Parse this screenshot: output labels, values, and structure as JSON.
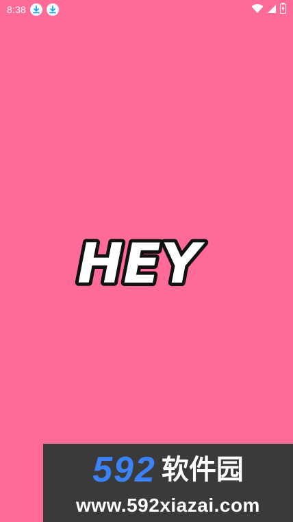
{
  "status_bar": {
    "time": "8:38",
    "notifications": [
      "download-icon",
      "download-icon"
    ],
    "indicators": [
      "wifi-icon",
      "signal-icon",
      "battery-charging-icon"
    ]
  },
  "splash": {
    "logo_text": "HEY"
  },
  "watermark": {
    "number": "592",
    "chinese": "软件园",
    "url": "www.592xiazai.com"
  },
  "colors": {
    "background": "#ff6b98",
    "download_icon": "#1da1f2",
    "watermark_bg": "#3a3a3a",
    "watermark_number": "#3b82f6"
  }
}
